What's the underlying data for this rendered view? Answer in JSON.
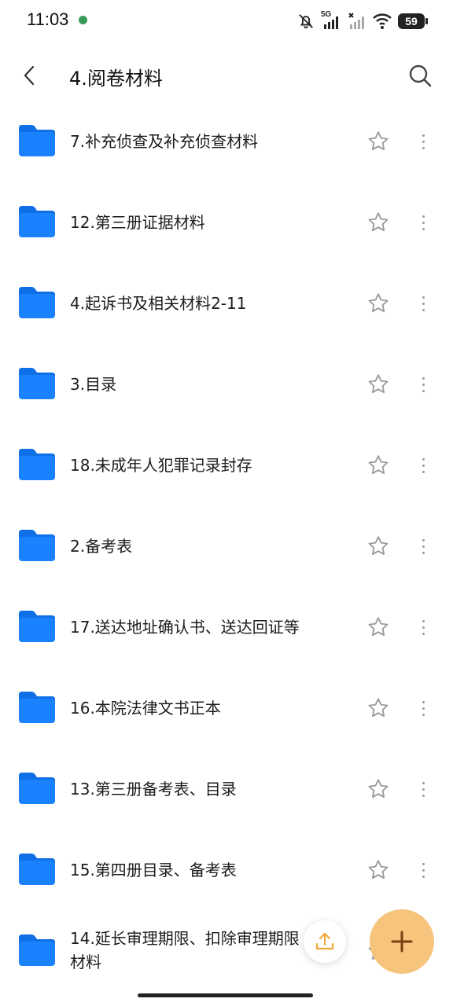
{
  "status_bar": {
    "time": "11:03",
    "network_label": "5G",
    "battery": "59",
    "icons": [
      "notifications-muted-icon",
      "signal-5g-icon",
      "signal-no-sim-icon",
      "wifi-icon",
      "battery-icon"
    ]
  },
  "header": {
    "title": "4.阅卷材料",
    "back_icon": "chevron-left-icon",
    "search_icon": "search-icon"
  },
  "folders": [
    {
      "name": "7.补充侦查及补充侦查材料"
    },
    {
      "name": "12.第三册证据材料"
    },
    {
      "name": "4.起诉书及相关材料2-11"
    },
    {
      "name": "3.目录"
    },
    {
      "name": "18.未成年人犯罪记录封存"
    },
    {
      "name": "2.备考表"
    },
    {
      "name": "17.送达地址确认书、送达回证等"
    },
    {
      "name": "16.本院法律文书正本"
    },
    {
      "name": "13.第三册备考表、目录"
    },
    {
      "name": "15.第四册目录、备考表"
    },
    {
      "name": "14.延长审理期限、扣除审理期限材料"
    }
  ],
  "fab": {
    "upload_icon": "upload-icon",
    "add_icon": "plus-icon"
  },
  "colors": {
    "folder": "#1a82ff",
    "fab": "#f6c47c",
    "fab_icon": "#7a3e10",
    "upload_icon": "#f0a83a"
  }
}
